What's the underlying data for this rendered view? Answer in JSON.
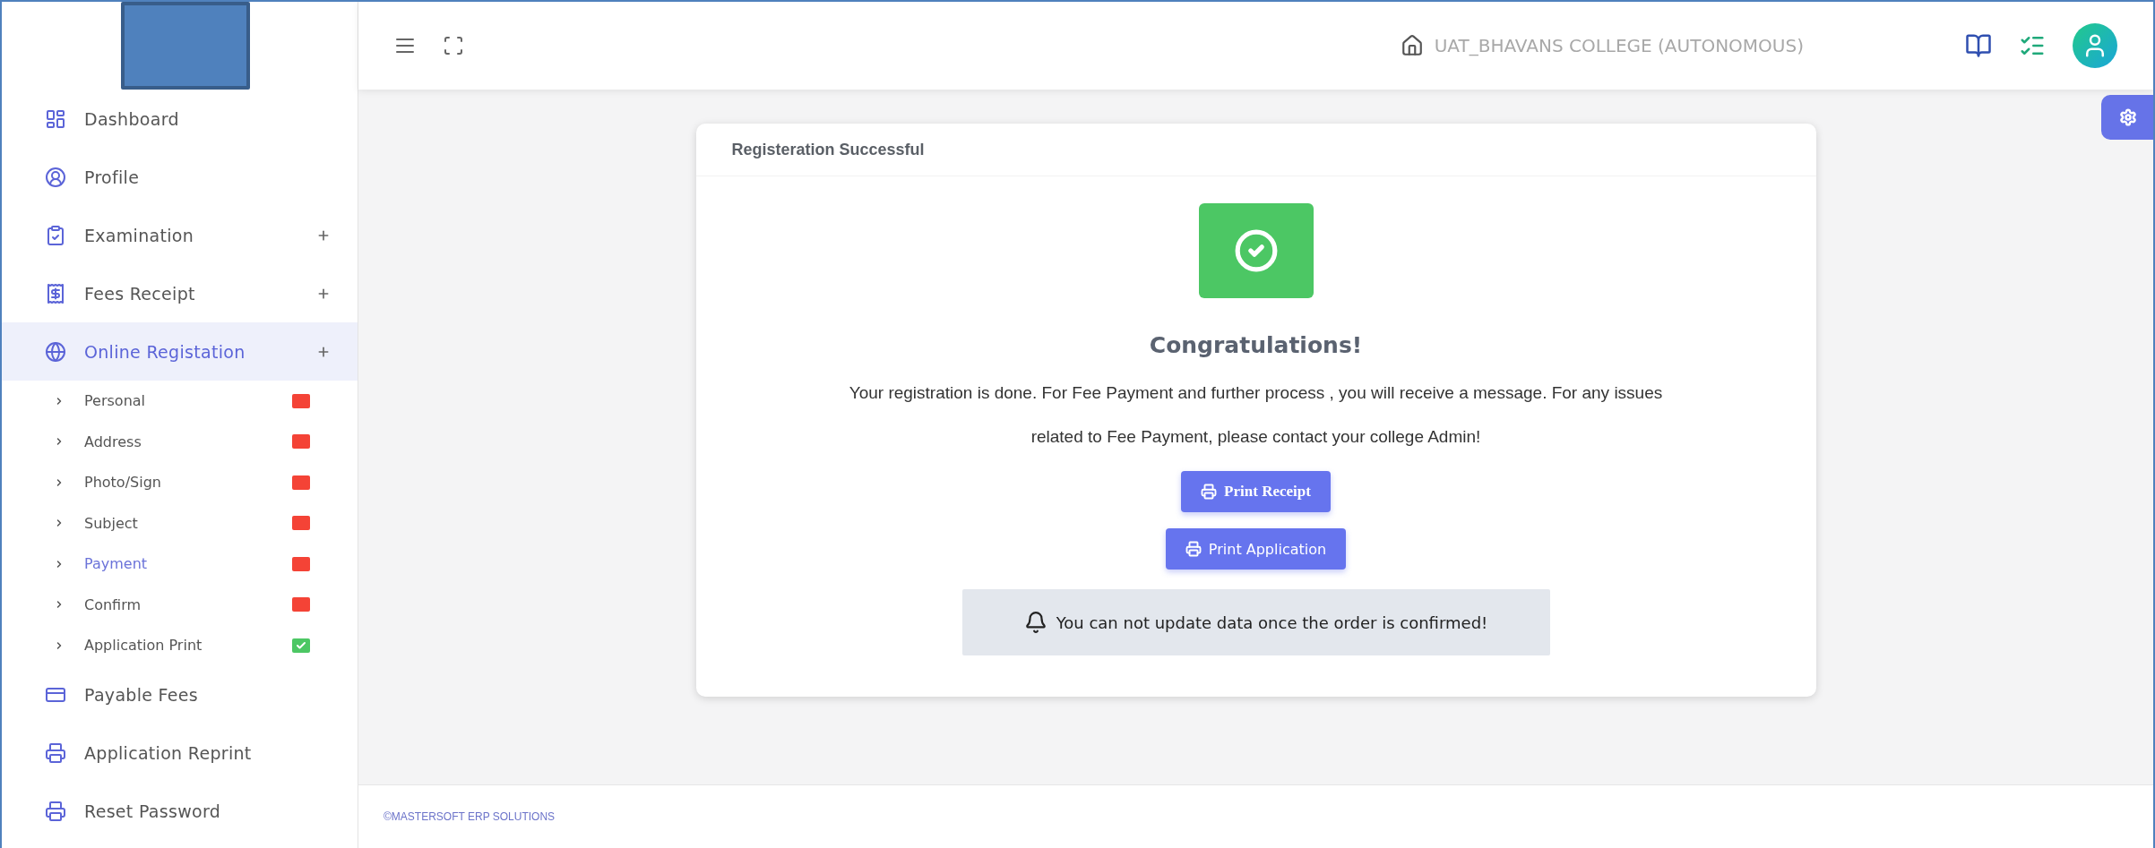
{
  "topbar": {
    "college_name": "UAT_BHAVANS COLLEGE (AUTONOMOUS)"
  },
  "sidebar": {
    "items": [
      {
        "label": "Dashboard",
        "has_submenu": false,
        "selected": false
      },
      {
        "label": "Profile",
        "has_submenu": false,
        "selected": false
      },
      {
        "label": "Examination",
        "has_submenu": true,
        "selected": false
      },
      {
        "label": "Fees Receipt",
        "has_submenu": true,
        "selected": false
      },
      {
        "label": "Online Registation",
        "has_submenu": true,
        "selected": true,
        "children": [
          {
            "label": "Personal",
            "done": false,
            "selected": false
          },
          {
            "label": "Address",
            "done": false,
            "selected": false
          },
          {
            "label": "Photo/Sign",
            "done": false,
            "selected": false
          },
          {
            "label": "Subject",
            "done": false,
            "selected": false
          },
          {
            "label": "Payment",
            "done": false,
            "selected": true
          },
          {
            "label": "Confirm",
            "done": false,
            "selected": false
          },
          {
            "label": "Application Print",
            "done": true,
            "selected": false
          }
        ]
      },
      {
        "label": "Payable Fees",
        "has_submenu": false,
        "selected": false
      },
      {
        "label": "Application Reprint",
        "has_submenu": false,
        "selected": false
      },
      {
        "label": "Reset Password",
        "has_submenu": false,
        "selected": false
      }
    ]
  },
  "card": {
    "title": "Registeration Successful",
    "heading": "Congratulations!",
    "message": "Your registration is done. For Fee Payment and further process , you will receive a message. For any issues related to Fee Payment, please contact your college Admin!",
    "buttons": [
      "Print Receipt",
      "Print Application"
    ],
    "notice": "You can not update data once the order is confirmed!"
  },
  "footer": "©MASTERSOFT ERP SOLUTIONS"
}
